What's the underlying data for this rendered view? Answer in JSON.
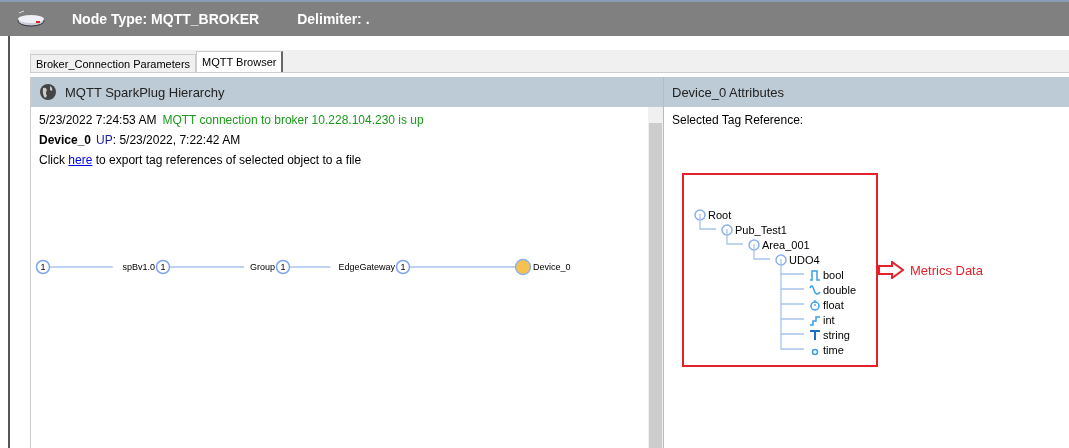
{
  "header": {
    "node_type": "Node Type: MQTT_BROKER",
    "delimiter": "Delimiter:  ."
  },
  "tabs": [
    {
      "label": "Broker_Connection Parameters",
      "selected": false
    },
    {
      "label": "MQTT Browser",
      "selected": true
    }
  ],
  "hierarchy_panel": {
    "title": "MQTT SparkPlug Hierarchy",
    "log_time": "5/23/2022 7:24:53 AM",
    "log_message": "MQTT connection to broker 10.228.104.230 is up",
    "device_name": "Device_0",
    "device_status": "UP",
    "device_status_time": ": 5/23/2022, 7:22:42 AM",
    "export_prefix": "Click ",
    "export_link": "here",
    "export_suffix": " to export tag references of selected object to a file",
    "graph": [
      {
        "kind": "count",
        "count": "1"
      },
      {
        "kind": "count",
        "label": "spBv1.0",
        "count": "1"
      },
      {
        "kind": "count",
        "label": "Group",
        "count": "1"
      },
      {
        "kind": "count",
        "label": "EdgeGateway",
        "count": "1"
      },
      {
        "kind": "device",
        "label": "Device_0"
      }
    ]
  },
  "attributes_panel": {
    "title": "Device_0 Attributes",
    "selected_tag_label": "Selected Tag Reference:",
    "tree": [
      {
        "label": "Root",
        "kind": "folder",
        "children": [
          {
            "label": "Pub_Test1",
            "kind": "folder",
            "children": [
              {
                "label": "Area_001",
                "kind": "folder",
                "children": [
                  {
                    "label": "UDO4",
                    "kind": "folder",
                    "children": [
                      {
                        "label": "bool",
                        "kind": "bool"
                      },
                      {
                        "label": "double",
                        "kind": "double"
                      },
                      {
                        "label": "float",
                        "kind": "float"
                      },
                      {
                        "label": "int",
                        "kind": "int"
                      },
                      {
                        "label": "string",
                        "kind": "string"
                      },
                      {
                        "label": "time",
                        "kind": "time"
                      }
                    ]
                  }
                ]
              }
            ]
          }
        ]
      }
    ],
    "annotation": "Metrics Data"
  }
}
